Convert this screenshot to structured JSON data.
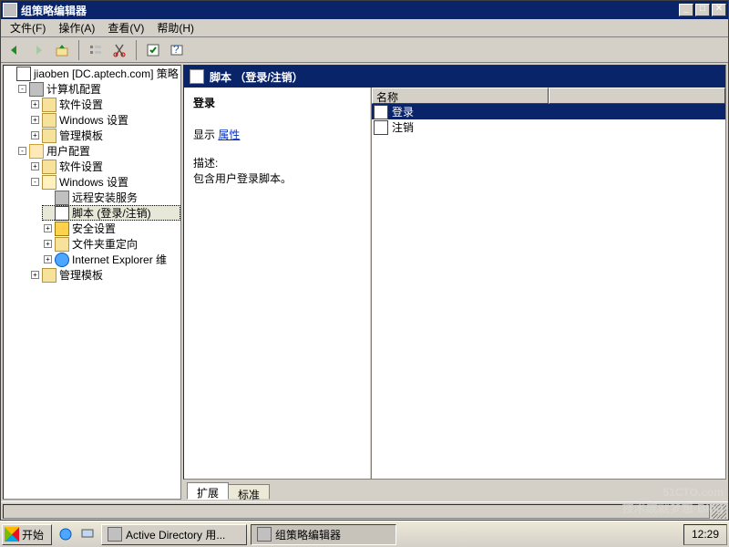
{
  "window": {
    "title": "组策略编辑器",
    "buttons": {
      "min": "_",
      "max": "□",
      "close": "✕"
    }
  },
  "menubar": [
    {
      "key": "file",
      "label": "文件(F)"
    },
    {
      "key": "action",
      "label": "操作(A)"
    },
    {
      "key": "view",
      "label": "查看(V)"
    },
    {
      "key": "help",
      "label": "帮助(H)"
    }
  ],
  "toolbar": {
    "back": "back-arrow",
    "forward": "forward-arrow",
    "up": "folder-up",
    "cut": "cut",
    "copy": "copy",
    "paste": "paste",
    "props": "props",
    "help": "help"
  },
  "tree": {
    "root": "jiaoben [DC.aptech.com] 策略",
    "computer": {
      "label": "计算机配置",
      "children": [
        {
          "key": "sw",
          "label": "软件设置"
        },
        {
          "key": "win",
          "label": "Windows 设置"
        },
        {
          "key": "tpl",
          "label": "管理模板"
        }
      ]
    },
    "user": {
      "label": "用户配置",
      "children": [
        {
          "key": "sw",
          "label": "软件设置"
        },
        {
          "key": "win",
          "label": "Windows 设置",
          "children": [
            {
              "key": "ris",
              "label": "远程安装服务"
            },
            {
              "key": "script",
              "label": "脚本 (登录/注销)"
            },
            {
              "key": "sec",
              "label": "安全设置"
            },
            {
              "key": "fdr",
              "label": "文件夹重定向"
            },
            {
              "key": "ie",
              "label": "Internet Explorer 维"
            }
          ]
        },
        {
          "key": "tpl",
          "label": "管理模板"
        }
      ]
    }
  },
  "detail": {
    "banner": "脚本 （登录/注销）",
    "heading": "登录",
    "show_label": "显示",
    "show_link": "属性",
    "desc_label": "描述:",
    "desc_body": "包含用户登录脚本。",
    "column": "名称",
    "rows": [
      {
        "key": "login",
        "label": "登录"
      },
      {
        "key": "logout",
        "label": "注销"
      }
    ],
    "tabs": {
      "extended": "扩展",
      "standard": "标准"
    }
  },
  "taskbar": {
    "start": "开始",
    "items": [
      {
        "key": "aduc",
        "label": "Active Directory 用..."
      },
      {
        "key": "gpe",
        "label": "组策略编辑器"
      }
    ],
    "clock": "12:29"
  },
  "watermark": {
    "line1": "51CTO.com",
    "line2": "技术成就梦想·Blog"
  }
}
